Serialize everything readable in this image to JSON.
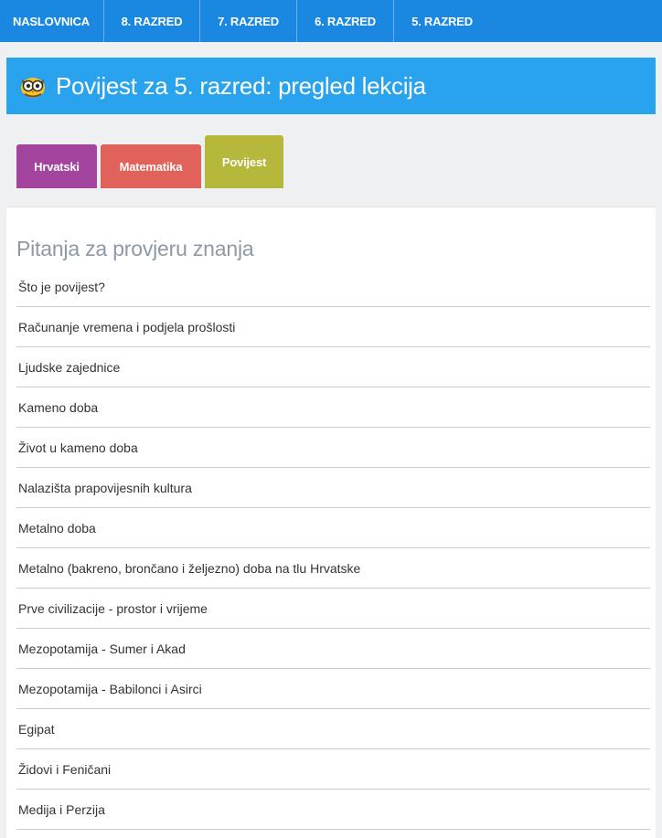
{
  "topnav": {
    "items": [
      {
        "label": "NASLOVNICA"
      },
      {
        "label": "8. RAZRED"
      },
      {
        "label": "7. RAZRED"
      },
      {
        "label": "6. RAZRED"
      },
      {
        "label": "5. RAZRED"
      }
    ]
  },
  "header": {
    "title": "Povijest za 5. razred: pregled lekcija",
    "icon": "owl-icon"
  },
  "tabs": [
    {
      "label": "Hrvatski",
      "color": "#a3449e"
    },
    {
      "label": "Matematika",
      "color": "#e0625a"
    },
    {
      "label": "Povijest",
      "color": "#b5b83a",
      "active": true
    }
  ],
  "main": {
    "section_title": "Pitanja za provjeru znanja",
    "lessons": [
      {
        "label": "Što je povijest?"
      },
      {
        "label": "Računanje vremena i podjela prošlosti"
      },
      {
        "label": "Ljudske zajednice"
      },
      {
        "label": "Kameno doba"
      },
      {
        "label": "Život u kameno doba"
      },
      {
        "label": "Nalazišta prapovijesnih kultura"
      },
      {
        "label": "Metalno doba"
      },
      {
        "label": "Metalno (bakreno, brončano i željezno) doba na tlu Hrvatske"
      },
      {
        "label": "Prve civilizacije - prostor i vrijeme"
      },
      {
        "label": "Mezopotamija - Sumer i Akad"
      },
      {
        "label": "Mezopotamija - Babilonci i Asirci"
      },
      {
        "label": "Egipat"
      },
      {
        "label": "Židovi i Feničani"
      },
      {
        "label": "Medija i Perzija"
      }
    ]
  },
  "colors": {
    "nav_bg": "#1a88e0",
    "banner_bg": "#29a3ee",
    "section_title": "#8c9aa8"
  }
}
